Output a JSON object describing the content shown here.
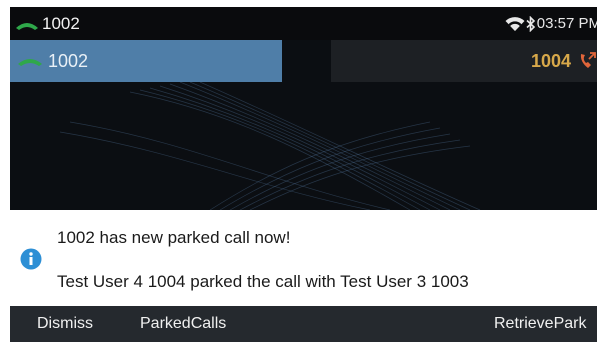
{
  "status_bar": {
    "account": "1002",
    "time": "03:57 PM",
    "icons": [
      "phone-handset-icon",
      "wifi-icon",
      "bluetooth-icon"
    ]
  },
  "lines": [
    {
      "label": "1002",
      "state": "active",
      "icon": "phone-handset-icon",
      "color": "#4f7ea8"
    },
    {
      "label": "1004",
      "state": "parked",
      "icon": "parked-call-icon",
      "color": "#d7a84a"
    }
  ],
  "notification": {
    "icon": "info-icon",
    "title": "1002 has new parked call now!",
    "body": "Test User 4 1004 parked the call with Test User 3 1003"
  },
  "softkeys": [
    {
      "label": "Dismiss"
    },
    {
      "label": "ParkedCalls"
    },
    {
      "label": "RetrievePark"
    }
  ],
  "colors": {
    "accent_green": "#2fa84a",
    "info_blue": "#2d8fd5",
    "parked_orange": "#e0653a"
  }
}
